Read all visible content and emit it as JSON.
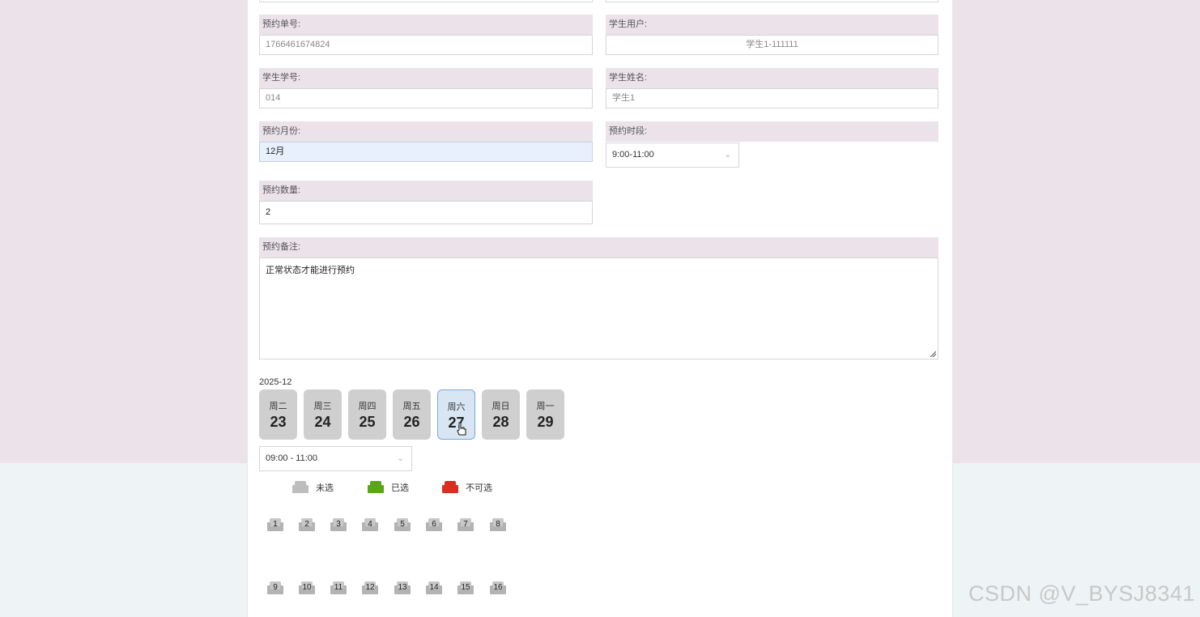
{
  "form": {
    "order_no": {
      "label": "预约单号:",
      "value": "1766461674824"
    },
    "student_user": {
      "label": "学生用户:",
      "value": "学生1-111111"
    },
    "student_id": {
      "label": "学生学号:",
      "value": "014"
    },
    "student_name": {
      "label": "学生姓名:",
      "value": "学生1"
    },
    "month": {
      "label": "预约月份:",
      "value": "12月"
    },
    "period": {
      "label": "预约时段:",
      "value": "9:00-11:00"
    },
    "quantity": {
      "label": "预约数量:",
      "value": "2"
    },
    "remark": {
      "label": "预约备注:",
      "value": "正常状态才能进行预约"
    }
  },
  "calendar": {
    "month": "2025-12",
    "days": [
      {
        "week": "周二",
        "day": "23"
      },
      {
        "week": "周三",
        "day": "24"
      },
      {
        "week": "周四",
        "day": "25"
      },
      {
        "week": "周五",
        "day": "26"
      },
      {
        "week": "周六",
        "day": "27",
        "selected": true
      },
      {
        "week": "周日",
        "day": "28"
      },
      {
        "week": "周一",
        "day": "29"
      }
    ],
    "time_slot": "09:00 - 11:00"
  },
  "legend": {
    "unselected": "未选",
    "selected": "已选",
    "unavailable": "不可选"
  },
  "colors": {
    "unselected": "#bdbdbd",
    "selected": "#5aa51c",
    "unavailable": "#d7301f"
  },
  "seats": [
    "1",
    "2",
    "3",
    "4",
    "5",
    "6",
    "7",
    "8",
    "9",
    "10",
    "11",
    "12",
    "13",
    "14",
    "15",
    "16"
  ],
  "watermark": "CSDN @V_BYSJ8341"
}
